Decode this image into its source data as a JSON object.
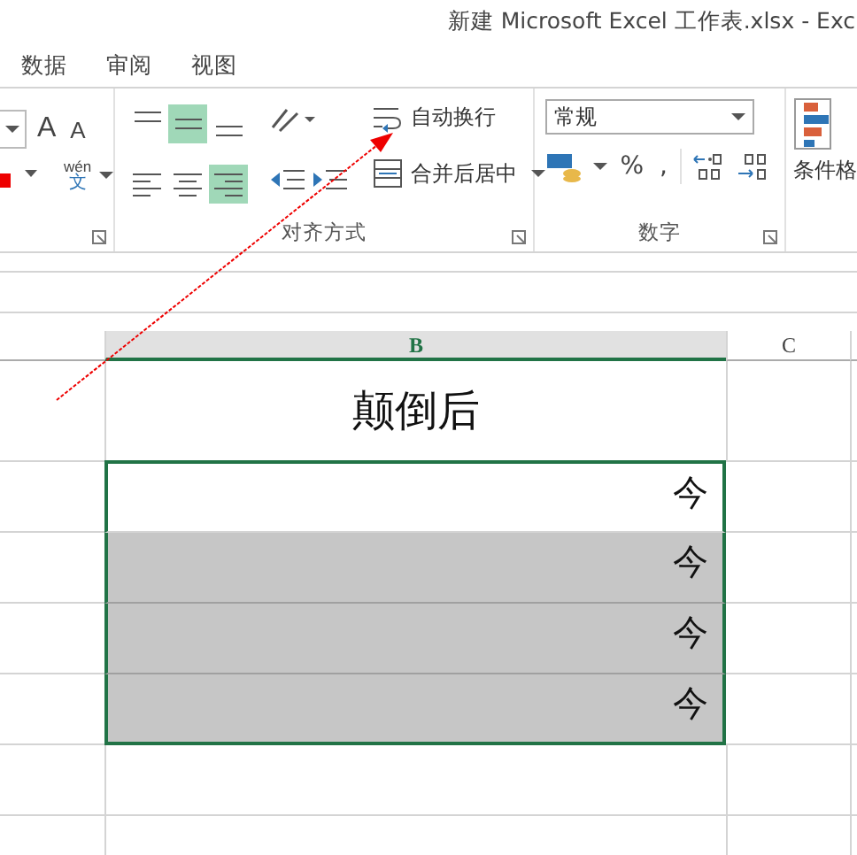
{
  "window": {
    "title": "新建 Microsoft Excel 工作表.xlsx - Exc"
  },
  "tabs": [
    {
      "label": "数据",
      "selected": false
    },
    {
      "label": "审阅",
      "selected": false
    },
    {
      "label": "视图",
      "selected": false
    }
  ],
  "ribbon": {
    "font": {
      "grow": "A",
      "shrink": "A",
      "phonetic_top": "wén",
      "phonetic_bottom": "文"
    },
    "alignment": {
      "label": "对齐方式",
      "buttons": [
        {
          "kind": "top",
          "selected": false
        },
        {
          "kind": "middle",
          "selected": true
        },
        {
          "kind": "bottom",
          "selected": false
        },
        {
          "kind": "left",
          "selected": false
        },
        {
          "kind": "center",
          "selected": false
        },
        {
          "kind": "right",
          "selected": true
        }
      ],
      "wrap_text": "自动换行",
      "merge_center": "合并后居中"
    },
    "number": {
      "label": "数字",
      "format": "常规",
      "percent": "%",
      "comma": ","
    },
    "styles": {
      "conditional_format": "条件格"
    }
  },
  "sheet": {
    "columns": [
      {
        "label": "B",
        "selected": true
      },
      {
        "label": "C",
        "selected": false
      }
    ],
    "header_cell": "颠倒后",
    "cells": [
      {
        "text": "今",
        "highlighted": false
      },
      {
        "text": "今",
        "highlighted": true
      },
      {
        "text": "今",
        "highlighted": true
      },
      {
        "text": "今",
        "highlighted": true
      }
    ]
  }
}
